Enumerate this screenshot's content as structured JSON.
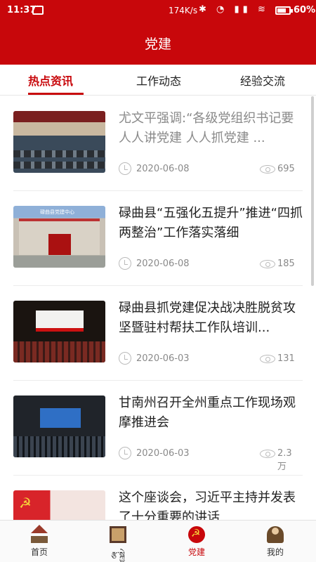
{
  "status_bar": {
    "time": "11:37",
    "speed": "174K/s",
    "icons": "✱ ◔ ▮▮ ≋",
    "battery": "60%"
  },
  "header": {
    "title": "党建"
  },
  "tabs": [
    {
      "label": "热点资讯",
      "active": true
    },
    {
      "label": "工作动态",
      "active": false
    },
    {
      "label": "经验交流",
      "active": false
    }
  ],
  "news": [
    {
      "title": "尤文平强调:“各级党组织书记要人人讲党建 人人抓党建 ...",
      "date": "2020-06-08",
      "views": "695",
      "read": true
    },
    {
      "title": "碌曲县“五强化五提升”推进“四抓两整治”工作落实落细",
      "date": "2020-06-08",
      "views": "185",
      "read": false
    },
    {
      "title": "碌曲县抓党建促决战决胜脱贫攻坚暨驻村帮扶工作队培训...",
      "date": "2020-06-03",
      "views": "131",
      "read": false
    },
    {
      "title": "甘南州召开全州重点工作现场观摩推进会",
      "date": "2020-06-03",
      "views": "2.3万",
      "read": false
    },
    {
      "title": "这个座谈会，习近平主持并发表了十分重要的讲话",
      "date": "",
      "views": "",
      "read": false
    }
  ],
  "thumb_text": {
    "item2_sign": "碌曲县党建中心"
  },
  "bottom_nav": [
    {
      "label": "首页",
      "icon": "home-icon",
      "active": false
    },
    {
      "label": "རྩ་སྐྱེ",
      "icon": "gate-icon",
      "active": false
    },
    {
      "label": "党建",
      "icon": "party-emblem-icon",
      "active": true
    },
    {
      "label": "我的",
      "icon": "profile-icon",
      "active": false
    }
  ],
  "colors": {
    "brand": "#c8070b",
    "muted": "#8a8a8a"
  }
}
